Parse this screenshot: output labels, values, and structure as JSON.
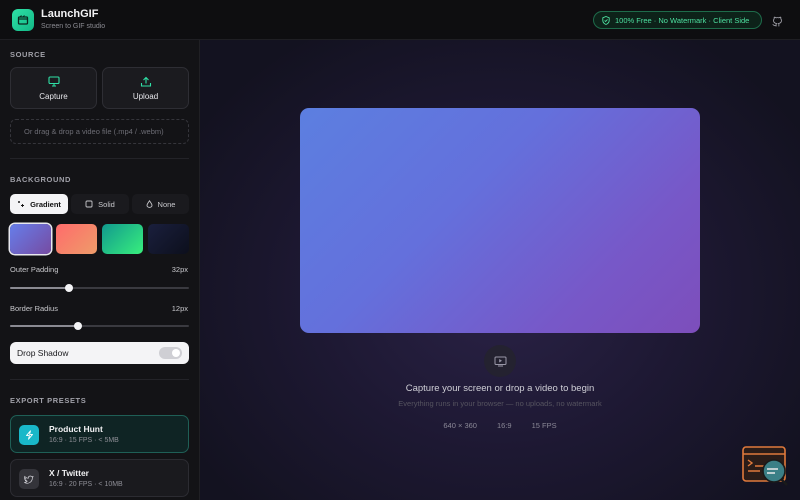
{
  "app": {
    "name": "LaunchGIF",
    "tagline": "Screen to GIF studio",
    "badge": "100% Free · No Watermark · Client Side"
  },
  "sidebar": {
    "source": {
      "title": "SOURCE",
      "capture_label": "Capture",
      "upload_label": "Upload",
      "drop_hint": "Or drag & drop a video file (.mp4 / .webm)"
    },
    "background": {
      "title": "BACKGROUND",
      "modes": [
        "Gradient",
        "Solid",
        "None"
      ],
      "active_mode": "Gradient",
      "swatches": [
        {
          "name": "indigo-violet",
          "colors": [
            "#667eea",
            "#764ba2"
          ]
        },
        {
          "name": "coral",
          "colors": [
            "#ff6b6b",
            "#ee9c6a"
          ]
        },
        {
          "name": "teal",
          "colors": [
            "#11998e",
            "#38ef7d"
          ]
        },
        {
          "name": "midnight",
          "colors": [
            "#141830",
            "#0c0f1c"
          ]
        }
      ],
      "selected_swatch": 0,
      "padding": {
        "label": "Outer Padding",
        "value": "32px",
        "level": 0.33
      },
      "radius": {
        "label": "Border Radius",
        "value": "12px",
        "level": 0.38
      },
      "shadow": {
        "label": "Drop Shadow",
        "enabled": true
      }
    },
    "export": {
      "title": "EXPORT PRESETS",
      "presets": [
        {
          "name": "Product Hunt",
          "meta": "16:9 · 15 FPS · < 5MB",
          "icon": "bolt-icon",
          "active": true
        },
        {
          "name": "X / Twitter",
          "meta": "16:9 · 20 FPS · < 10MB",
          "icon": "twitter-icon",
          "active": false
        }
      ]
    }
  },
  "preview": {
    "title": "Capture your screen or drop a video to begin",
    "subtitle": "Everything runs in your browser — no uploads, no watermark",
    "meta": [
      "640 × 360",
      "16:9",
      "15 FPS"
    ]
  },
  "colors": {
    "accent": "#2fe0a6",
    "badge_text": "#4ee0a0",
    "sidebar_bg": "#131316"
  }
}
